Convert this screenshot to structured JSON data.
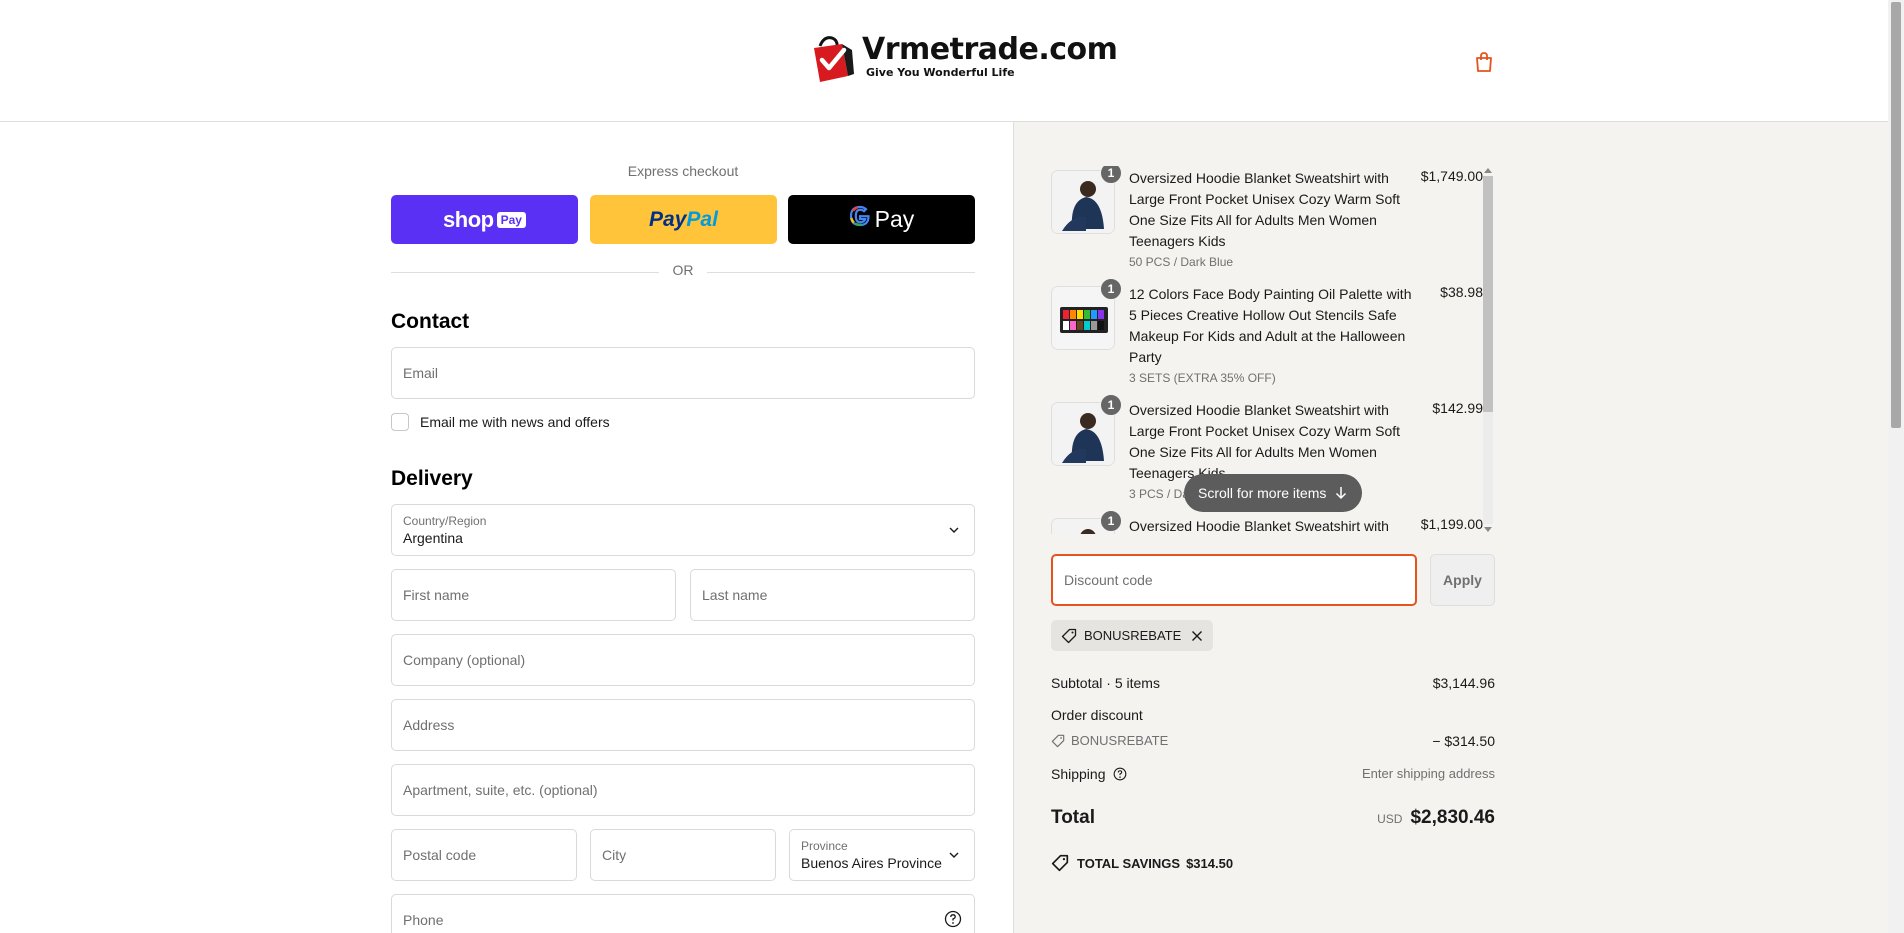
{
  "header": {
    "brand_name": "Vrmetrade.com",
    "tagline": "Give You Wonderful Life"
  },
  "express": {
    "label": "Express checkout",
    "shop_pay": {
      "shop": "shop",
      "pay": "Pay"
    },
    "paypal": {
      "pay": "Pay",
      "pal": "Pal"
    },
    "gpay": {
      "g": "G",
      "pay": "Pay"
    },
    "or_text": "OR"
  },
  "contact": {
    "title": "Contact",
    "email_placeholder": "Email",
    "newsletter_label": "Email me with news and offers"
  },
  "delivery": {
    "title": "Delivery",
    "country_label": "Country/Region",
    "country_value": "Argentina",
    "first_name_placeholder": "First name",
    "last_name_placeholder": "Last name",
    "company_placeholder": "Company (optional)",
    "address_placeholder": "Address",
    "apartment_placeholder": "Apartment, suite, etc. (optional)",
    "postal_placeholder": "Postal code",
    "city_placeholder": "City",
    "province_label": "Province",
    "province_value": "Buenos Aires Province",
    "phone_placeholder": "Phone"
  },
  "items": [
    {
      "qty": "1",
      "name": "Oversized Hoodie Blanket Sweatshirt with Large Front Pocket Unisex Cozy Warm Soft One Size Fits All for Adults Men Women Teenagers Kids",
      "variant": "50 PCS / Dark Blue",
      "price": "$1,749.00"
    },
    {
      "qty": "1",
      "name": "12 Colors Face Body Painting Oil Palette with 5 Pieces Creative Hollow Out Stencils Safe Makeup For Kids and Adult at the Halloween Party",
      "variant": "3 SETS (EXTRA 35% OFF)",
      "price": "$38.98"
    },
    {
      "qty": "1",
      "name": "Oversized Hoodie Blanket Sweatshirt with Large Front Pocket Unisex Cozy Warm Soft One Size Fits All for Adults Men Women Teenagers Kids",
      "variant": "3 PCS / Dark Blue",
      "price": "$142.99"
    },
    {
      "qty": "1",
      "name": "Oversized Hoodie Blanket Sweatshirt with",
      "variant": "",
      "price": "$1,199.00"
    }
  ],
  "scroll_hint": "Scroll for more items",
  "discount": {
    "placeholder": "Discount code",
    "apply_label": "Apply",
    "applied_code": "BONUSREBATE"
  },
  "summary": {
    "subtotal_label": "Subtotal · 5 items",
    "subtotal_value": "$3,144.96",
    "order_discount_label": "Order discount",
    "discount_code": "BONUSREBATE",
    "discount_value": "− $314.50",
    "shipping_label": "Shipping",
    "shipping_value": "Enter shipping address",
    "total_label": "Total",
    "currency": "USD",
    "total_value": "$2,830.46",
    "savings_label": "TOTAL SAVINGS",
    "savings_value": "$314.50"
  },
  "colors": {
    "accent": "#e5541c",
    "shop_pay": "#5a31f4",
    "paypal": "#ffc439",
    "summary_bg": "#f5f3f0"
  }
}
